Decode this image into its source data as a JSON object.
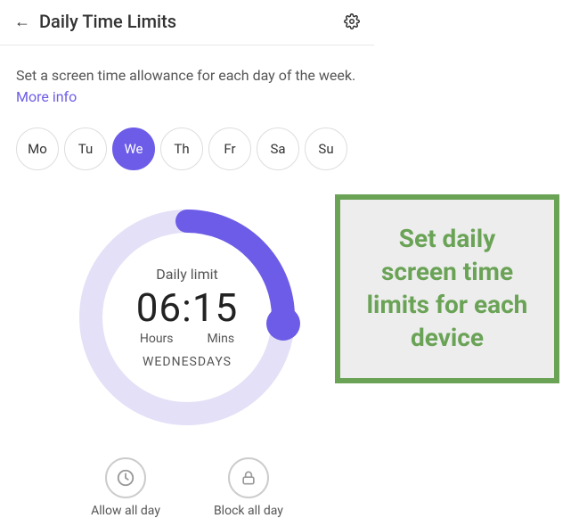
{
  "header": {
    "title": "Daily Time Limits"
  },
  "description": {
    "text": "Set a screen time allowance for each day of the week. ",
    "more_info": "More info"
  },
  "days": [
    {
      "abbr": "Mo",
      "active": false
    },
    {
      "abbr": "Tu",
      "active": false
    },
    {
      "abbr": "We",
      "active": true
    },
    {
      "abbr": "Th",
      "active": false
    },
    {
      "abbr": "Fr",
      "active": false
    },
    {
      "abbr": "Sa",
      "active": false
    },
    {
      "abbr": "Su",
      "active": false
    }
  ],
  "gauge": {
    "label": "Daily limit",
    "time": "06:15",
    "hours_label": "Hours",
    "mins_label": "Mins",
    "day_name": "WEDNESDAYS",
    "progress_fraction": 0.26
  },
  "actions": {
    "allow": "Allow all day",
    "block": "Block all day"
  },
  "callout": {
    "text": "Set daily screen time limits for each device"
  },
  "colors": {
    "accent": "#6c5ce7",
    "callout_green": "#6aa356"
  }
}
